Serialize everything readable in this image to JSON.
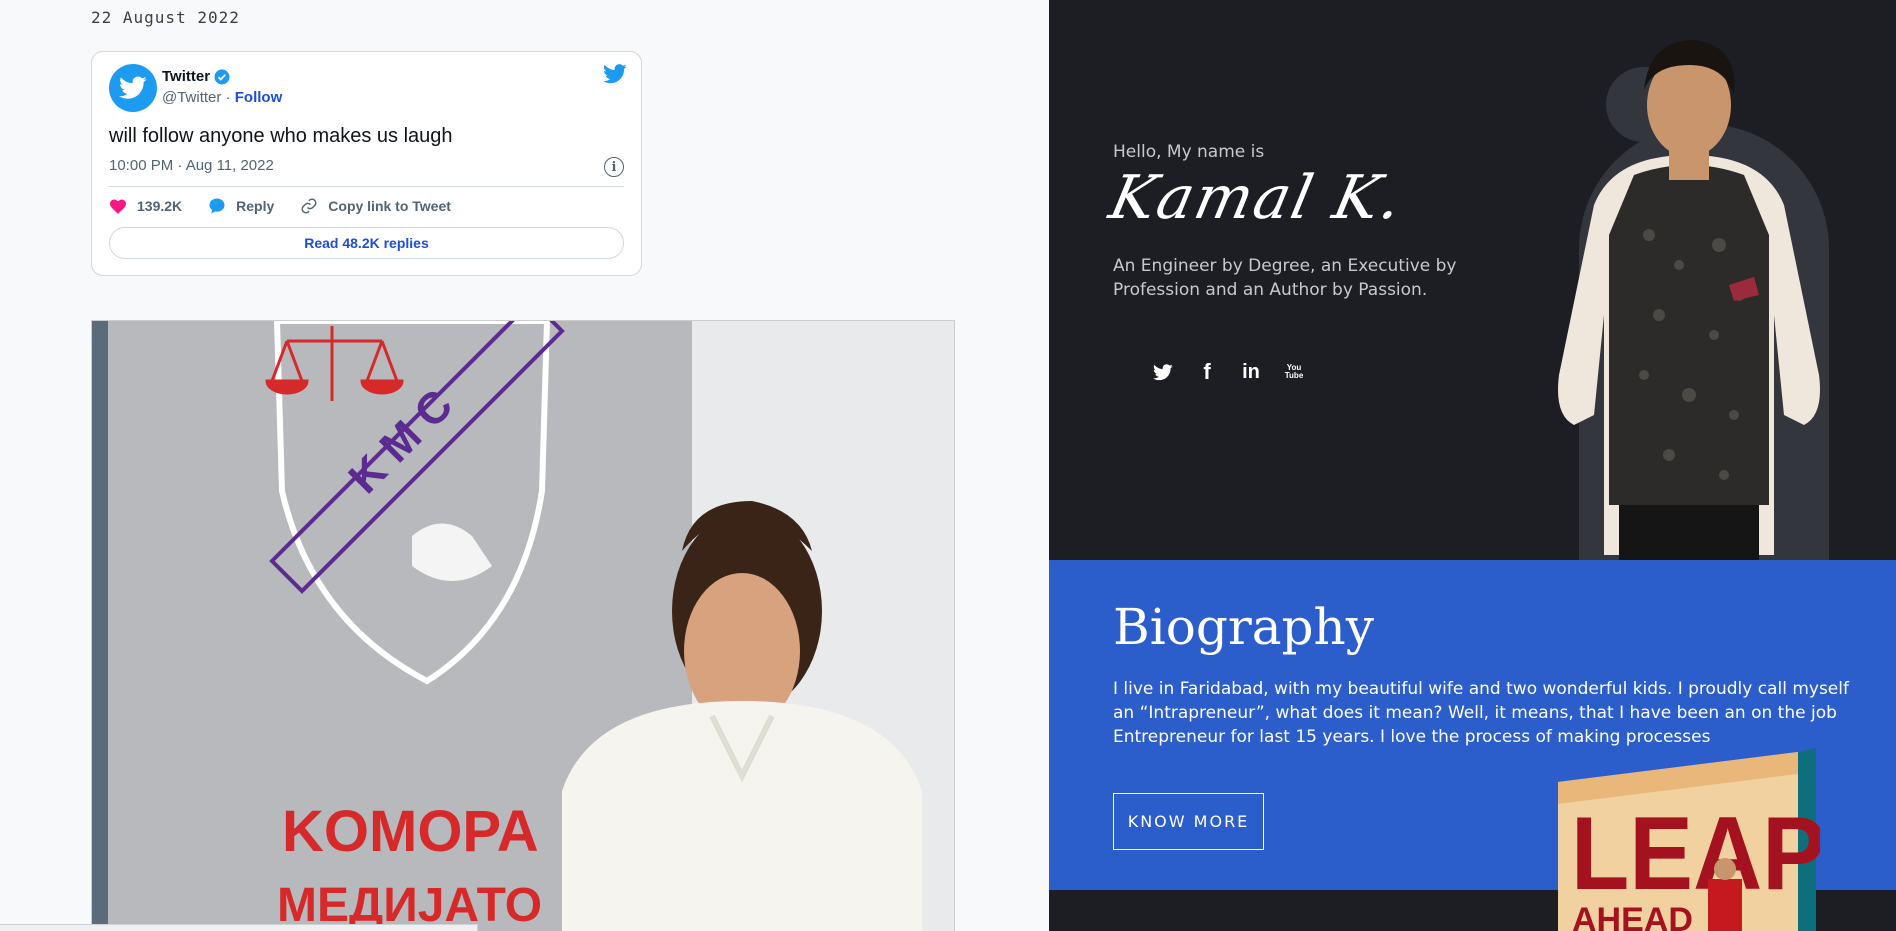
{
  "post": {
    "date": "22 August 2022"
  },
  "tweet": {
    "account_name": "Twitter",
    "handle": "@Twitter",
    "separator": "·",
    "follow_label": "Follow",
    "text": "will follow anyone who makes us laugh",
    "timestamp": "10:00 PM · Aug 11, 2022",
    "likes": "139.2K",
    "reply_label": "Reply",
    "copy_link_label": "Copy link to Tweet",
    "read_replies_label": "Read 48.2K replies",
    "brand_color": "#1d9bf0",
    "like_color": "#f91880"
  },
  "photo": {
    "sign_letters": "K M C",
    "sign_text": "KOMOPA",
    "sign_text_2": "МЕДИЈАТО"
  },
  "hero": {
    "greeting": "Hello, My name is",
    "signature": "Kamal K.",
    "tagline": "An Engineer by Degree, an Executive by Profession and an Author by Passion.",
    "socials": [
      "twitter-icon",
      "facebook-icon",
      "linkedin-icon",
      "youtube-icon"
    ],
    "social_labels": {
      "facebook": "f",
      "linkedin": "in",
      "youtube": "You Tube"
    }
  },
  "biography": {
    "title": "Biography",
    "text": "I live in Faridabad, with my beautiful wife and two wonderful kids. I proudly call myself an “Intrapreneur”, what does it mean? Well, it means, that I have been an on the job Entrepreneur for last 15 years. I love the process of making processes",
    "button_label": "KNOW MORE",
    "accent": "#2b5dcb"
  },
  "book": {
    "title_line1": "LEAP",
    "title_line2": "AHEAD"
  }
}
